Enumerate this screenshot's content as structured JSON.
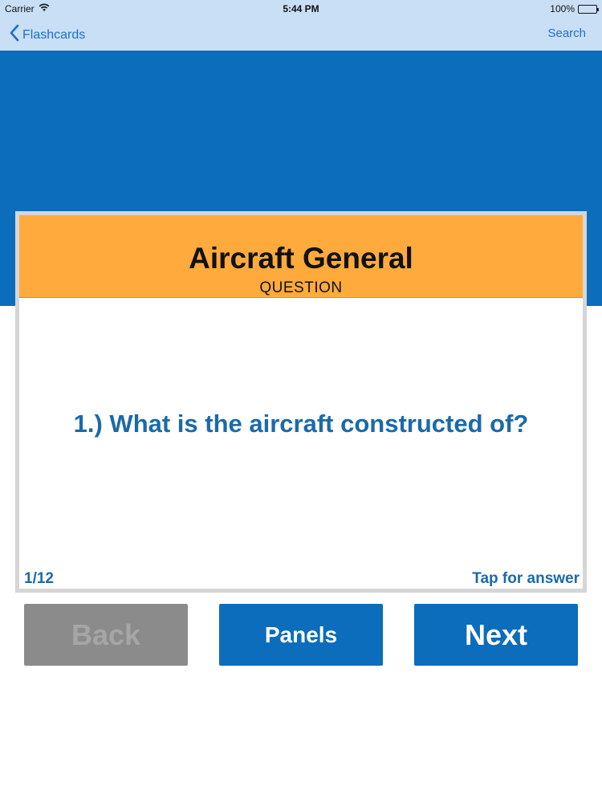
{
  "status_bar": {
    "carrier": "Carrier",
    "time": "5:44 PM",
    "battery": "100%",
    "wifi_icon": "wifi-icon",
    "battery_icon": "battery-icon"
  },
  "nav": {
    "back_label": "Flashcards",
    "back_icon": "chevron-left-icon",
    "search_label": "Search",
    "color": "#1f6fc8",
    "background": "#c9dff6"
  },
  "card": {
    "title": "Aircraft General",
    "subtitle": "QUESTION",
    "question": "1.) What is the aircraft constructed of?",
    "counter": "1/12",
    "tap_hint": "Tap for answer",
    "header_color": "#ffaa3c",
    "text_color": "#1b6aaa"
  },
  "buttons": {
    "back": "Back",
    "panels": "Panels",
    "next": "Next",
    "primary_color": "#0b6dbb",
    "disabled_color": "#8b8b8b"
  }
}
